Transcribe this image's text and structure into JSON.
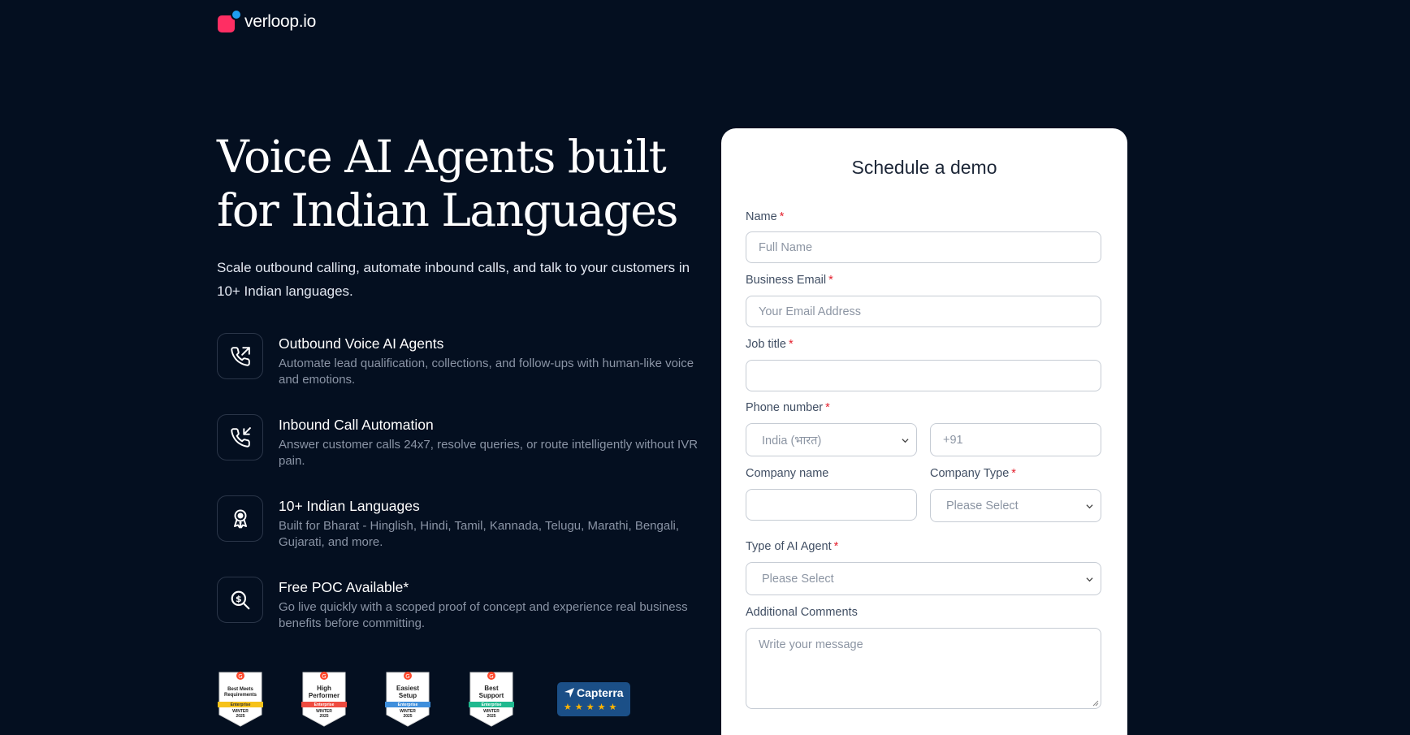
{
  "logo": {
    "text": "verloop.io"
  },
  "hero": {
    "title_line1": "Voice AI Agents built",
    "title_line2": "for Indian Languages",
    "subtitle": "Scale outbound calling, automate inbound calls, and talk to your customers in 10+ Indian languages."
  },
  "features": [
    {
      "icon": "phone-outgoing-icon",
      "title": "Outbound Voice AI Agents",
      "desc": "Automate lead qualification, collections, and follow-ups with human-like voice and emotions."
    },
    {
      "icon": "phone-incoming-icon",
      "title": "Inbound Call Automation",
      "desc": "Answer customer calls 24x7, resolve queries, or route intelligently without IVR pain."
    },
    {
      "icon": "award-ribbon-icon",
      "title": "10+ Indian Languages",
      "desc": "Built for Bharat - Hinglish, Hindi, Tamil, Kannada, Telugu, Marathi, Bengali, Gujarati, and more."
    },
    {
      "icon": "search-dollar-icon",
      "title": "Free POC Available*",
      "desc": "Go live quickly with a scoped proof of concept and experience real business benefits before committing."
    }
  ],
  "badges": [
    {
      "line1": "Best Meets",
      "line2": "Requirements",
      "ribbon": "Enterprise",
      "season": "WINTER",
      "year": "2025",
      "ribbon_color": "#f6c21a"
    },
    {
      "line1": "High",
      "line2": "Performer",
      "ribbon": "Enterprise",
      "season": "WINTER",
      "year": "2025",
      "ribbon_color": "#ef4b3f"
    },
    {
      "line1": "Easiest",
      "line2": "Setup",
      "ribbon": "Enterprise",
      "season": "WINTER",
      "year": "2025",
      "ribbon_color": "#3f8fdc"
    },
    {
      "line1": "Best",
      "line2": "Support",
      "ribbon": "Enterprise",
      "season": "WINTER",
      "year": "2025",
      "ribbon_color": "#1fb98f"
    }
  ],
  "capterra": {
    "name": "Capterra",
    "stars": "★★★★★"
  },
  "form": {
    "title": "Schedule a demo",
    "name_label": "Name",
    "name_placeholder": "Full Name",
    "email_label": "Business Email",
    "email_placeholder": "Your Email Address",
    "job_label": "Job title",
    "phone_label": "Phone number",
    "country_value": "India (भारत)",
    "phone_placeholder": "+91",
    "company_label": "Company name",
    "company_type_label": "Company Type",
    "company_type_value": "Please Select",
    "agent_type_label": "Type of AI Agent",
    "agent_type_value": "Please Select",
    "comments_label": "Additional Comments",
    "comments_placeholder": "Write your message",
    "required_mark": "*"
  }
}
